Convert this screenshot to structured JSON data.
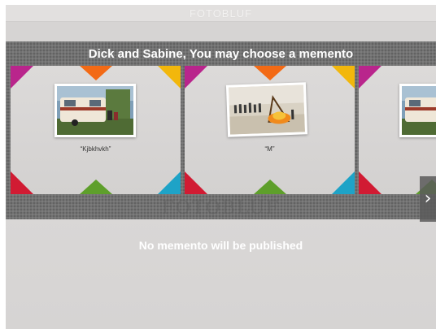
{
  "app": {
    "brand": "FOTOBLUF",
    "watermark": "FOTOBLUF"
  },
  "band": {
    "title": "Dick and Sabine, You may choose a memento"
  },
  "cards": [
    {
      "caption": "“Kjbkhvkh”",
      "photo": "caravan-photo"
    },
    {
      "caption": "“M”",
      "photo": "bonfire-photo"
    },
    {
      "caption": "",
      "photo": "caravan-photo"
    }
  ],
  "navigation": {
    "next_icon": "chevron-right-icon",
    "next_glyph": "›"
  },
  "status": {
    "message": "No memento will be published"
  },
  "colors": {
    "band": "#727272",
    "magenta": "#b9258c",
    "orange": "#f36a15",
    "yellow": "#f2b70c",
    "red": "#d11b33",
    "green": "#5e9f2b",
    "cyan": "#1ea3c7"
  }
}
